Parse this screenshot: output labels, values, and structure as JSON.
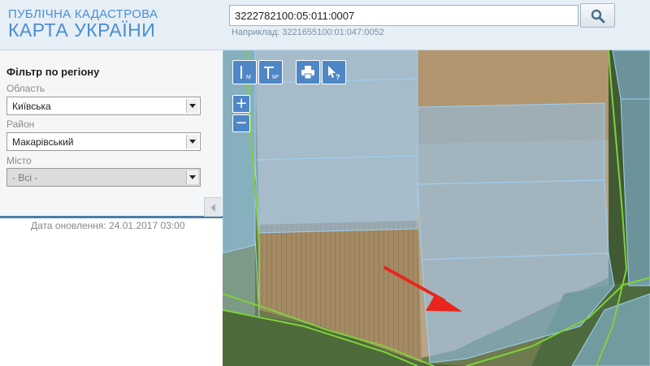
{
  "header": {
    "logo_line1": "ПУБЛІЧНА КАДАСТРОВА",
    "logo_line2": "КАРТА УКРАЇНИ",
    "search_value": "3222782100:05:011:0007",
    "search_hint": "Наприклад: 3221655100:01:047:0052",
    "search_icon": "magnifier-icon"
  },
  "sidebar": {
    "filter_title": "Фільтр по регіону",
    "fields": [
      {
        "label": "Область",
        "value": "Київська",
        "disabled": false
      },
      {
        "label": "Район",
        "value": "Макарівський",
        "disabled": false
      },
      {
        "label": "Місто",
        "value": "- Всі -",
        "disabled": true
      }
    ],
    "update_date": "Дата оновлення: 24.01.2017 03:00"
  },
  "map": {
    "tools": [
      {
        "name": "measure-length",
        "icon": "ruler-line-icon"
      },
      {
        "name": "measure-area",
        "icon": "ruler-area-icon"
      },
      {
        "name": "print",
        "icon": "printer-icon"
      },
      {
        "name": "identify",
        "icon": "pointer-question-icon"
      }
    ],
    "zoom_in": "+",
    "zoom_out": "−",
    "parcel_color": "#8fc2ee",
    "boundary_color": "#7fd13b",
    "arrow_color": "#e8261e"
  }
}
